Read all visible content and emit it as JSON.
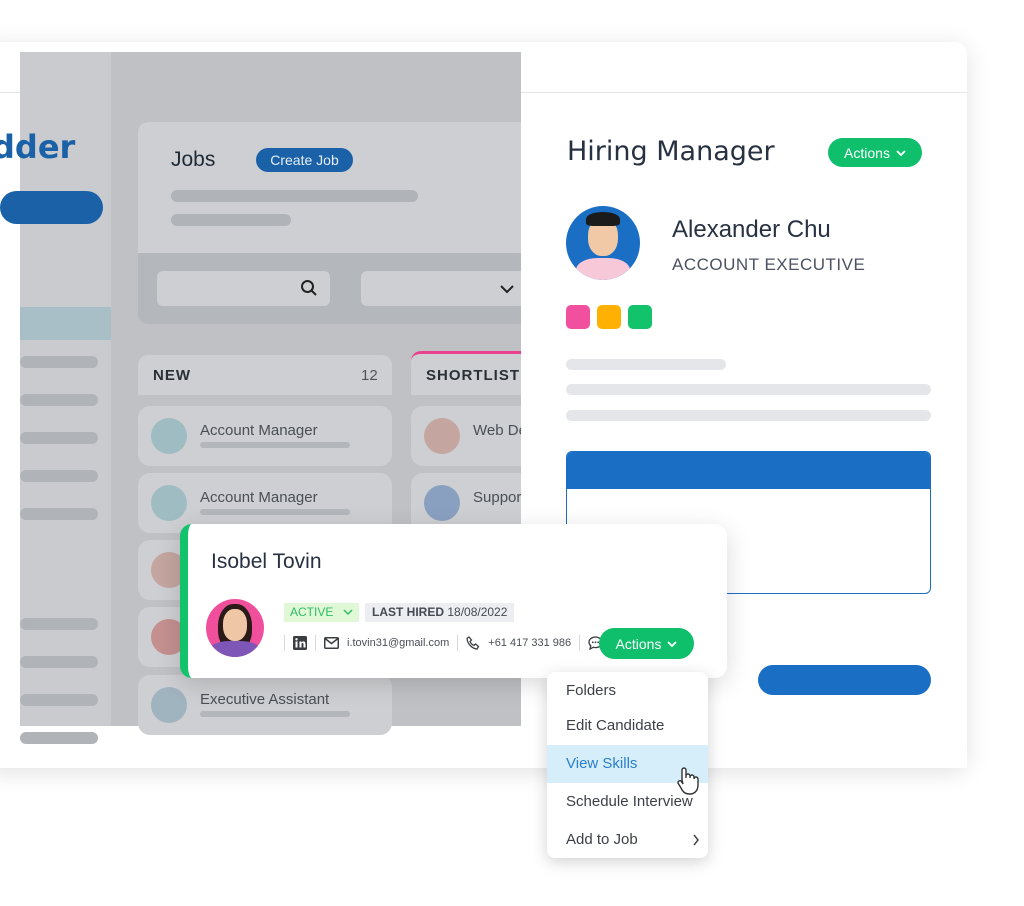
{
  "sidebar": {
    "logo_text": "dder"
  },
  "jobs": {
    "title": "Jobs",
    "create_button": "Create Job"
  },
  "columns": [
    {
      "label": "NEW",
      "count": "12"
    },
    {
      "label": "SHORTLISTE"
    }
  ],
  "new_jobs": [
    "Account Manager",
    "Account Manager",
    "",
    "",
    "Executive Assistant"
  ],
  "shortlisted_jobs": [
    "Web De",
    "Suppor"
  ],
  "hiring_manager": {
    "heading": "Hiring Manager",
    "actions_label": "Actions",
    "name": "Alexander Chu",
    "title": "ACCOUNT EXECUTIVE",
    "tag_colors": [
      "#f0509e",
      "#ffb000",
      "#12c36b"
    ]
  },
  "candidate": {
    "name": "Isobel Tovin",
    "status": "ACTIVE",
    "last_hired_label": "LAST HIRED",
    "last_hired_date": "18/08/2022",
    "email": "i.tovin31@gmail.com",
    "phone": "+61 417 331 986",
    "actions_label": "Actions"
  },
  "menu": {
    "items": [
      "Folders",
      "Edit Candidate",
      "View Skills",
      "Schedule Interview",
      "Add to Job"
    ],
    "highlighted": "View Skills"
  },
  "colors": {
    "accent_green": "#0fbf6c",
    "brand_blue": "#1a6fc4",
    "pink": "#e8418f"
  }
}
